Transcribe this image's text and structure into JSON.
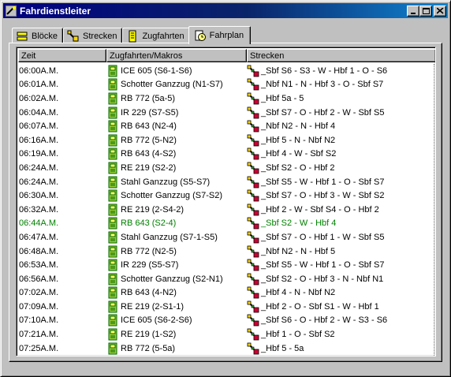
{
  "window": {
    "title": "Fahrdienstleiter"
  },
  "tabs": [
    {
      "label": "Blöcke",
      "icon": "blocks-icon",
      "active": false
    },
    {
      "label": "Strecken",
      "icon": "tracks-icon",
      "active": false
    },
    {
      "label": "Zugfahrten",
      "icon": "train-runs-icon",
      "active": false
    },
    {
      "label": "Fahrplan",
      "icon": "timetable-icon",
      "active": true
    }
  ],
  "table": {
    "columns": [
      "Zeit",
      "Zugfahrten/Makros",
      "Strecken"
    ],
    "rows": [
      {
        "time": "06:00A.M.",
        "train": "ICE 605 (S6-1-S6)",
        "route": "_Sbf S6 - S3 - W - Hbf 1 - O - S6"
      },
      {
        "time": "06:01A.M.",
        "train": "Schotter Ganzzug (N1-S7)",
        "route": "_Nbf N1 - N - Hbf 3 - O - Sbf S7"
      },
      {
        "time": "06:02A.M.",
        "train": "RB 772 (5a-5)",
        "route": "_Hbf 5a - 5"
      },
      {
        "time": "06:04A.M.",
        "train": "IR 229 (S7-S5)",
        "route": "_Sbf S7 - O - Hbf 2 - W - Sbf S5"
      },
      {
        "time": "06:07A.M.",
        "train": "RB 643 (N2-4)",
        "route": "_Nbf N2 - N - Hbf 4"
      },
      {
        "time": "06:16A.M.",
        "train": "RB 772 (5-N2)",
        "route": "_Hbf 5 - N - Nbf N2"
      },
      {
        "time": "06:19A.M.",
        "train": "RB 643 (4-S2)",
        "route": "_Hbf 4 - W - Sbf S2"
      },
      {
        "time": "06:24A.M.",
        "train": "RE 219 (S2-2)",
        "route": "_Sbf S2 - O - Hbf 2"
      },
      {
        "time": "06:24A.M.",
        "train": "Stahl Ganzzug (S5-S7)",
        "route": "_Sbf S5 - W - Hbf 1 - O - Sbf S7"
      },
      {
        "time": "06:30A.M.",
        "train": "Schotter Ganzzug (S7-S2)",
        "route": "_Sbf S7 - O - Hbf 3 - W - Sbf S2"
      },
      {
        "time": "06:32A.M.",
        "train": "RE 219 (2-S4-2)",
        "route": "_Hbf 2 - W - Sbf S4 - O - Hbf 2"
      },
      {
        "time": "06:44A.M.",
        "train": "RB 643 (S2-4)",
        "route": "_Sbf S2 - W - Hbf 4",
        "highlight": true
      },
      {
        "time": "06:47A.M.",
        "train": "Stahl Ganzzug (S7-1-S5)",
        "route": "_Sbf S7 - O - Hbf 1 - W - Sbf S5"
      },
      {
        "time": "06:48A.M.",
        "train": "RB 772 (N2-5)",
        "route": "_Nbf N2 - N - Hbf 5"
      },
      {
        "time": "06:53A.M.",
        "train": "IR 229 (S5-S7)",
        "route": "_Sbf S5 - W - Hbf 1 - O - Sbf S7"
      },
      {
        "time": "06:56A.M.",
        "train": "Schotter Ganzzug (S2-N1)",
        "route": "_Sbf S2 - O - Hbf 3 - N - Nbf N1"
      },
      {
        "time": "07:02A.M.",
        "train": "RB 643 (4-N2)",
        "route": "_Hbf 4 - N - Nbf N2"
      },
      {
        "time": "07:09A.M.",
        "train": "RE 219 (2-S1-1)",
        "route": "_Hbf 2 - O - Sbf S1 - W - Hbf 1"
      },
      {
        "time": "07:10A.M.",
        "train": "ICE 605 (S6-2-S6)",
        "route": "_Sbf S6 - O - Hbf 2 - W - S3 - S6"
      },
      {
        "time": "07:21A.M.",
        "train": "RE 219 (1-S2)",
        "route": "_Hbf 1 - O - Sbf S2"
      },
      {
        "time": "07:25A.M.",
        "train": "RB 772 (5-5a)",
        "route": "_Hbf 5 - 5a"
      }
    ]
  },
  "colors": {
    "titlebar_start": "#000080",
    "titlebar_end": "#1084d0",
    "highlight_text": "#008000",
    "train_icon": "#2e8b2e",
    "route_icon": "#b8860b"
  }
}
